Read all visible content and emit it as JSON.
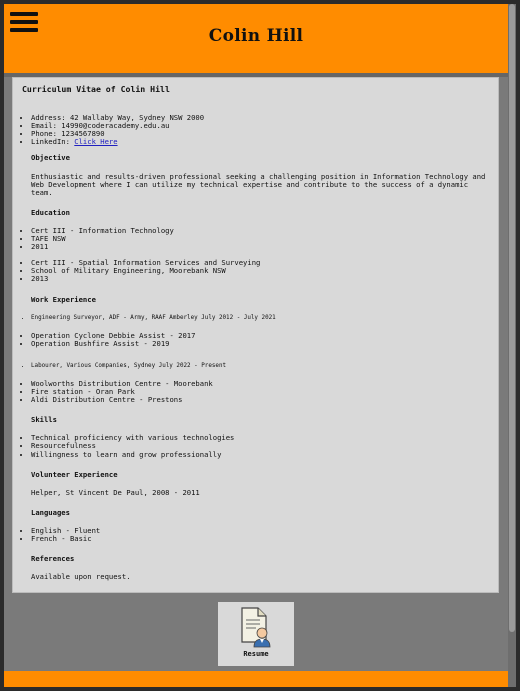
{
  "header": {
    "title": "Colin Hill",
    "menu_icon": "hamburger-menu-icon"
  },
  "cv": {
    "heading": "Curriculum Vitae of Colin Hill",
    "contact": {
      "address": "Address: 42 Wallaby Way, Sydney NSW 2000",
      "email": "Email: 14990@coderacademy.edu.au",
      "phone": "Phone: 1234567890",
      "linkedin_label": "LinkedIn: ",
      "linkedin_link": "Click Here"
    },
    "objective": {
      "heading": "Objective",
      "text": "Enthusiastic and results-driven professional seeking a challenging position in Information Technology and Web Development where I can utilize my technical expertise and contribute to the success of a dynamic team."
    },
    "education": {
      "heading": "Education",
      "group1": [
        "Cert III - Information Technology",
        "TAFE NSW",
        "2011"
      ],
      "group2": [
        "Cert III - Spatial Information Services and Surveying",
        "School of Military Engineering, Moorebank NSW",
        "2013"
      ]
    },
    "work": {
      "heading": "Work Experience",
      "job1": "Engineering Surveyor, ADF - Army, RAAF Amberley July 2012 - July 2021",
      "job1_items": [
        "Operation Cyclone Debbie Assist - 2017",
        "Operation Bushfire Assist - 2019"
      ],
      "job2": "Labourer, Various Companies, Sydney July 2022 - Present",
      "job2_items": [
        "Woolworths Distribution Centre - Moorebank",
        "Fire station - Oran Park",
        "Aldi Distribution Centre - Prestons"
      ]
    },
    "skills": {
      "heading": "Skills",
      "items": [
        "Technical proficiency with various technologies",
        "Resourcefulness",
        "Willingness to learn and grow professionally"
      ]
    },
    "volunteer": {
      "heading": "Volunteer Experience",
      "text": "Helper, St Vincent De Paul, 2008 - 2011"
    },
    "languages": {
      "heading": "Languages",
      "items": [
        "English - Fluent",
        "French - Basic"
      ]
    },
    "references": {
      "heading": "References",
      "text": "Available upon request."
    }
  },
  "resume_tile": {
    "label": "Resume",
    "icon": "resume-document-person-icon"
  },
  "colors": {
    "accent": "#ff8c00",
    "background": "#7a7a7a",
    "panel": "#d9d9d9",
    "link": "#2020c0"
  }
}
